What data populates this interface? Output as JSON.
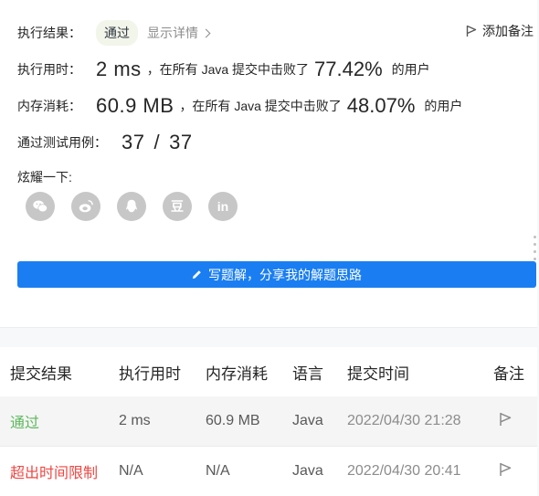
{
  "result": {
    "label": "执行结果：",
    "status": "通过",
    "detail_link": "显示详情",
    "add_note": "添加备注"
  },
  "runtime": {
    "label": "执行用时：",
    "value": "2 ms",
    "prefix": "，在所有 Java 提交中击败了",
    "percent": "77.42%",
    "suffix": "的用户"
  },
  "memory": {
    "label": "内存消耗：",
    "value": "60.9 MB",
    "prefix": "，在所有 Java 提交中击败了",
    "percent": "48.07%",
    "suffix": "的用户"
  },
  "tests": {
    "label": "通过测试用例：",
    "passed": "37",
    "sep": "/",
    "total": "37"
  },
  "share": {
    "label": "炫耀一下:",
    "icons": [
      "wechat-icon",
      "weibo-icon",
      "qq-icon",
      "douban-icon",
      "linkedin-icon"
    ],
    "douban_glyph": "豆",
    "linkedin_glyph": "in"
  },
  "write_button": "写题解，分享我的解题思路",
  "table": {
    "headers": [
      "提交结果",
      "执行用时",
      "内存消耗",
      "语言",
      "提交时间",
      "备注"
    ],
    "rows": [
      {
        "result": "通过",
        "runtime": "2 ms",
        "memory": "60.9 MB",
        "lang": "Java",
        "time": "2022/04/30 21:28"
      },
      {
        "result": "超出时间限制",
        "runtime": "N/A",
        "memory": "N/A",
        "lang": "Java",
        "time": "2022/04/30 20:41"
      }
    ]
  },
  "colors": {
    "accent": "#1a7ef2",
    "success": "#5cb85c",
    "error": "#ef4743"
  }
}
